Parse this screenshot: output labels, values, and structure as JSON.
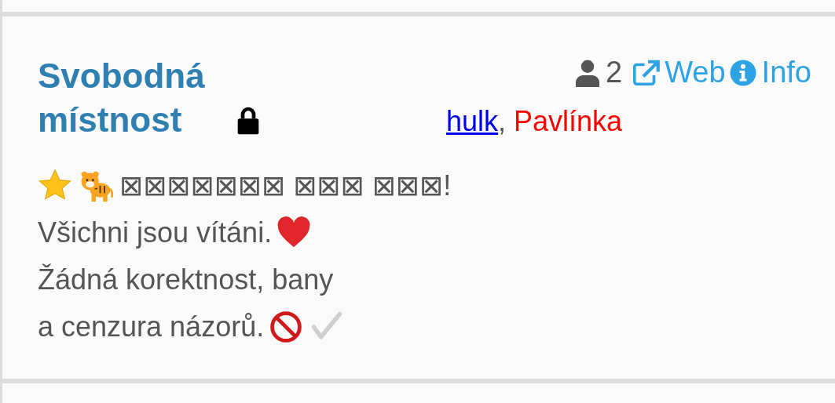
{
  "room": {
    "title": "Svobodná místnost",
    "locked": true,
    "member_count": "2",
    "links": [
      {
        "kind": "web",
        "label": "Web"
      },
      {
        "kind": "info",
        "label": "Info"
      }
    ],
    "users": [
      {
        "name": "hulk",
        "kind": "link",
        "color": "#0000ee"
      },
      {
        "name": "Pavlínka",
        "kind": "plain",
        "color": "#ff0000"
      }
    ],
    "user_separator": ",",
    "description": [
      [
        {
          "kind": "star"
        },
        {
          "kind": "tiger"
        },
        {
          "kind": "text",
          "text": "⊠⊠⊠⊠⊠⊠⊠ ⊠⊠⊠ ⊠⊠⊠!"
        }
      ],
      [
        {
          "kind": "text",
          "text": "Všichni jsou vítáni."
        },
        {
          "kind": "heart"
        }
      ],
      [
        {
          "kind": "text",
          "text": "Žádná korektnost, bany"
        }
      ],
      [
        {
          "kind": "text",
          "text": "a cenzura názorů."
        },
        {
          "kind": "prohibited"
        },
        {
          "kind": "check"
        }
      ]
    ]
  }
}
